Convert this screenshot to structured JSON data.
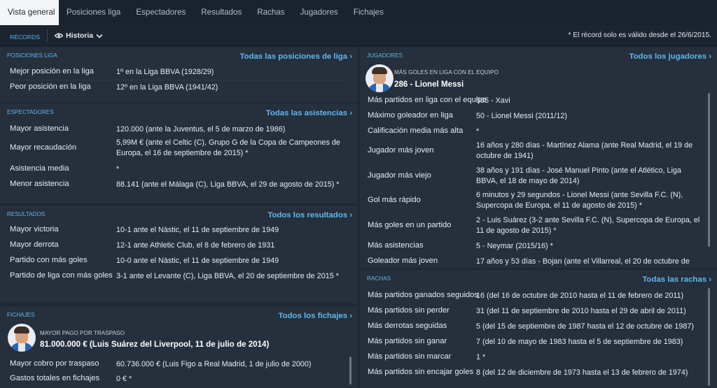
{
  "tabs": [
    "Vista general",
    "Posiciones liga",
    "Espectadores",
    "Resultados",
    "Rachas",
    "Jugadores",
    "Fichajes"
  ],
  "subbar": {
    "records": "RÉCORDS",
    "historia": "Historia",
    "note": "* El récord solo es válido desde el 26/6/2015."
  },
  "posiciones": {
    "title": "POSICIONES LIGA",
    "link": "Todas las posiciones de liga",
    "rows": [
      {
        "label": "Mejor posición en la liga",
        "value": "1º en la Liga BBVA (1928/29)"
      },
      {
        "label": "Peor posición en la liga",
        "value": "12º en la Liga BBVA (1941/42)"
      }
    ]
  },
  "espectadores": {
    "title": "ESPECTADORES",
    "link": "Todas las asistencias",
    "rows": [
      {
        "label": "Mayor asistencia",
        "value": "120.000 (ante la Juventus, el 5 de marzo de 1986)"
      },
      {
        "label": "Mayor recaudación",
        "value": "5,99M € (ante el Celtic (C), Grupo G de la Copa de Campeones de Europa, el 16 de septiembre de 2015) *"
      },
      {
        "label": "Asistencia media",
        "value": "*"
      },
      {
        "label": "Menor asistencia",
        "value": "88.141 (ante el Málaga (C), Liga BBVA, el 29 de agosto de 2015) *"
      }
    ]
  },
  "resultados": {
    "title": "RESULTADOS",
    "link": "Todos los resultados",
    "rows": [
      {
        "label": "Mayor victoria",
        "value": "10-1 ante el Nàstic, el 11 de septiembre de 1949"
      },
      {
        "label": "Mayor derrota",
        "value": "12-1 ante Athletic Club, el 8 de febrero de 1931"
      },
      {
        "label": "Partido con más goles",
        "value": "10-0 ante el Nàstic, el 11 de septiembre de 1949"
      },
      {
        "label": "Partido de liga con más goles",
        "value": "3-1 ante el Levante (C), Liga BBVA, el 20 de septiembre de 2015 *"
      }
    ]
  },
  "fichajes": {
    "title": "FICHAJES",
    "link": "Todos los fichajes",
    "feature_title": "MAYOR PAGO POR TRASPASO",
    "feature_value": "81.000.000 € (Luis Suárez del Liverpool, 11 de julio de 2014)",
    "rows": [
      {
        "label": "Mayor cobro por traspaso",
        "value": "60.736.000 € (Luis Figo a Real Madrid, 1 de julio de 2000)"
      },
      {
        "label": "Gastos totales en fichajes",
        "value": "0 € *"
      }
    ]
  },
  "jugadores": {
    "title": "JUGADORES",
    "link": "Todos los jugadores",
    "feature_title": "MÁS GOLES EN LIGA CON EL EQUIPO",
    "feature_value": "286 - Lionel Messi",
    "rows": [
      {
        "label": "Más partidos en liga con el equipo",
        "value": "505 - Xavi"
      },
      {
        "label": "Máximo goleador en liga",
        "value": "50 - Lionel Messi (2011/12)"
      },
      {
        "label": "Calificación media más alta",
        "value": "*"
      },
      {
        "label": "Jugador más joven",
        "value": "16 años y 280 días - Martínez Alama (ante Real Madrid, el 19 de octubre de 1941)"
      },
      {
        "label": "Jugador más viejo",
        "value": "38 años y 191 días - José Manuel Pinto (ante el Atlético, Liga BBVA, el 18 de mayo de 2014)"
      },
      {
        "label": "Gol más rápido",
        "value": "6 minutos y 29 segundos - Lionel Messi (ante Sevilla F.C. (N), Supercopa de Europa, el 11 de agosto de 2015) *"
      },
      {
        "label": "Más goles en un partido",
        "value": "2 - Luis Suárez (3-2 ante Sevilla F.C. (N), Supercopa de Europa, el 11 de agosto de 2015) *"
      },
      {
        "label": "Más asistencias",
        "value": "5 - Neymar (2015/16) *"
      },
      {
        "label": "Goleador más joven",
        "value": "17 años y 53 días - Bojan (ante el Villarreal, el 20 de octubre de"
      }
    ]
  },
  "rachas": {
    "title": "RACHAS",
    "link": "Todas las rachas",
    "rows": [
      {
        "label": "Más partidos ganados seguidos",
        "value": "16 (del 16 de octubre de 2010 hasta el 11 de febrero de 2011)"
      },
      {
        "label": "Más partidos sin perder",
        "value": "31 (del 11 de septiembre de 2010 hasta el 29 de abril de 2011)"
      },
      {
        "label": "Más derrotas seguidas",
        "value": "5 (del 15 de septiembre de 1987 hasta el 12 de octubre de 1987)"
      },
      {
        "label": "Más partidos sin ganar",
        "value": "7 (del 10 de mayo de 1983 hasta el 5 de septiembre de 1983)"
      },
      {
        "label": "Más partidos sin marcar",
        "value": "1 *"
      },
      {
        "label": "Más partidos sin encajar goles",
        "value": "8 (del 12 de diciembre de 1973 hasta el 13 de febrero de 1974)"
      }
    ]
  },
  "colors": {
    "accent": "#5eb8ee",
    "panel": "#262f3c",
    "background": "#1f2733",
    "tab_active": "#f3f5f7"
  }
}
